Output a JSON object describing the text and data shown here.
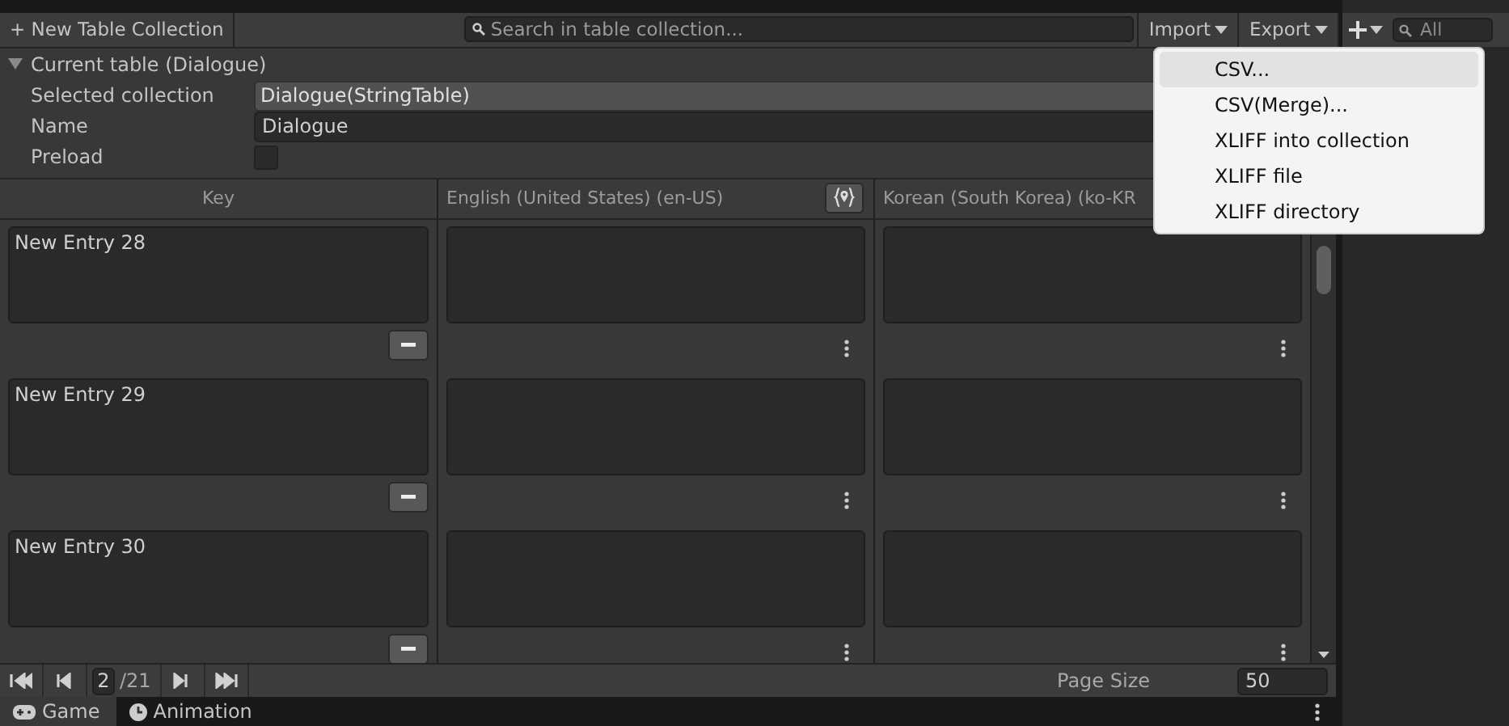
{
  "toolbar": {
    "new_button": "+ New Table Collection",
    "search": {
      "placeholder": "Search in table collection..."
    },
    "import_button": "Import",
    "export_button": "Export"
  },
  "current_table": {
    "title": "Current table (Dialogue)",
    "expanded": true,
    "fields": [
      {
        "label": "Selected collection",
        "kind": "dropdown",
        "value": "Dialogue(StringTable)"
      },
      {
        "label": "Name",
        "kind": "text",
        "value": "Dialogue"
      },
      {
        "label": "Preload",
        "kind": "checkbox",
        "checked": false
      }
    ]
  },
  "table": {
    "columns": [
      "Key",
      "English (United States) (en-US)",
      "Korean (South Korea) (ko-KR"
    ],
    "rows": [
      {
        "key": "New Entry 28"
      },
      {
        "key": "New Entry 29"
      },
      {
        "key": "New Entry 30"
      }
    ]
  },
  "pagination": {
    "page": "2",
    "total": "/21",
    "page_size_label": "Page Size",
    "page_size": "50"
  },
  "import_menu": [
    {
      "label": "CSV...",
      "selected": true
    },
    {
      "label": "CSV(Merge)...",
      "selected": false
    },
    {
      "label": "XLIFF into collection",
      "selected": false
    },
    {
      "label": "XLIFF file",
      "selected": false
    },
    {
      "label": "XLIFF directory",
      "selected": false
    }
  ],
  "hierarchy": {
    "search": {
      "placeholder": "All"
    }
  },
  "bottom_tabs": [
    {
      "label": "Game",
      "selected": true
    },
    {
      "label": "Animation",
      "selected": false
    }
  ]
}
